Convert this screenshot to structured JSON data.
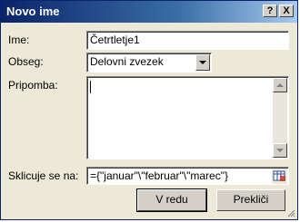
{
  "window": {
    "title": "Novo ime"
  },
  "titlebar": {
    "help_label": "?",
    "close_label": "X"
  },
  "form": {
    "name_label": "Ime:",
    "name_value": "Četrtletje1",
    "scope_label": "Obseg:",
    "scope_value": "Delovni zvezek",
    "comment_label": "Pripomba:",
    "comment_value": "",
    "refers_label": "Sklicuje se na:",
    "refers_value": "={\"januar\"\\\"februar\"\\\"marec\"}"
  },
  "buttons": {
    "ok_label": "V redu",
    "cancel_label": "Prekliči"
  },
  "colors": {
    "title_bar_start": "#0a246a",
    "title_bar_end": "#a6caf0",
    "dialog_bg": "#ece9d8"
  },
  "icons": {
    "help": "help-icon",
    "close": "close-icon",
    "dropdown": "chevron-down-icon",
    "collapse": "collapse-dialog-icon"
  }
}
